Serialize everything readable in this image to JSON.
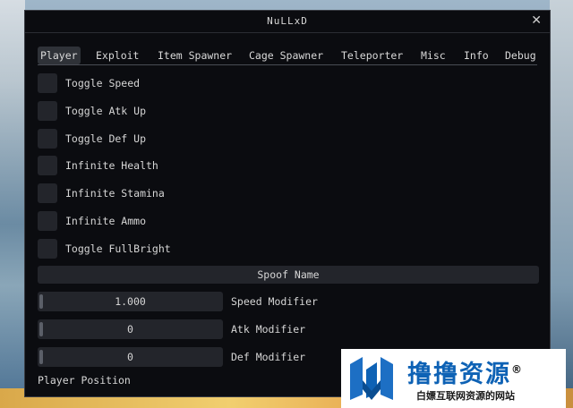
{
  "window": {
    "title": "NuLLxD",
    "close_glyph": "✕"
  },
  "tabs": [
    {
      "label": "Player",
      "active": true
    },
    {
      "label": "Exploit",
      "active": false
    },
    {
      "label": "Item Spawner",
      "active": false
    },
    {
      "label": "Cage Spawner",
      "active": false
    },
    {
      "label": "Teleporter",
      "active": false
    },
    {
      "label": "Misc",
      "active": false
    },
    {
      "label": "Info",
      "active": false
    },
    {
      "label": "Debug",
      "active": false
    }
  ],
  "toggles": [
    {
      "label": "Toggle Speed",
      "checked": false
    },
    {
      "label": "Toggle Atk Up",
      "checked": false
    },
    {
      "label": "Toggle Def Up",
      "checked": false
    },
    {
      "label": "Infinite Health",
      "checked": false
    },
    {
      "label": "Infinite Stamina",
      "checked": false
    },
    {
      "label": "Infinite Ammo",
      "checked": false
    },
    {
      "label": "Toggle FullBright",
      "checked": false
    }
  ],
  "spoof_button": "Spoof Name",
  "sliders": [
    {
      "value": "1.000",
      "label": "Speed Modifier"
    },
    {
      "value": "0",
      "label": "Atk Modifier"
    },
    {
      "value": "0",
      "label": "Def Modifier"
    }
  ],
  "section_label": "Player Position",
  "watermark": {
    "title": "撸撸资源",
    "registered": "®",
    "subtitle": "白嫖互联网资源的网站",
    "colors": {
      "brand": "#0e62b5"
    }
  }
}
